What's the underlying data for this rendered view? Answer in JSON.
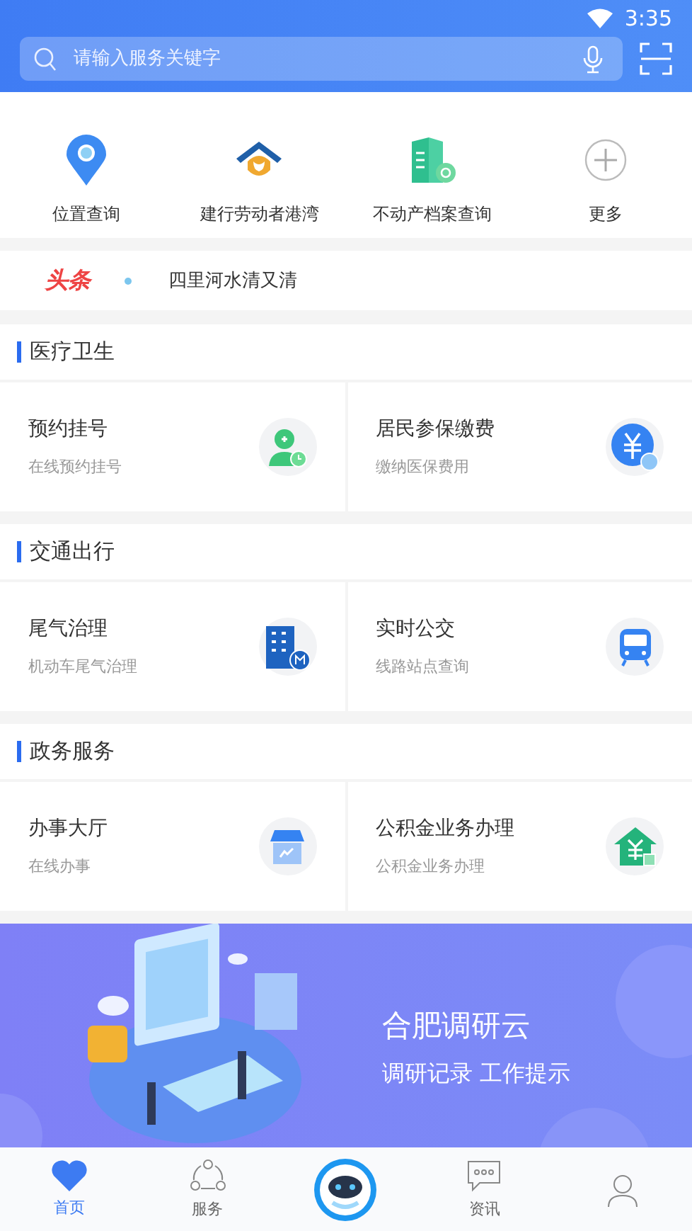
{
  "status_bar": {
    "time": "3:35"
  },
  "search": {
    "placeholder": "请输入服务关键字"
  },
  "quick_services": [
    {
      "kind": "pin",
      "label": "位置查询"
    },
    {
      "kind": "house",
      "label": "建行劳动者港湾"
    },
    {
      "kind": "building",
      "label": "不动产档案查询"
    },
    {
      "kind": "more",
      "label": "更多"
    }
  ],
  "headline": {
    "source": "头条",
    "text": "四里河水清又清"
  },
  "sections": [
    {
      "title": "医疗卫生",
      "cards": [
        {
          "kind": "doctor",
          "title": "预约挂号",
          "subtitle": "在线预约挂号"
        },
        {
          "kind": "yuan",
          "title": "居民参保缴费",
          "subtitle": "缴纳医保费用"
        }
      ]
    },
    {
      "title": "交通出行",
      "cards": [
        {
          "kind": "office",
          "title": "尾气治理",
          "subtitle": "机动车尾气治理"
        },
        {
          "kind": "bus",
          "title": "实时公交",
          "subtitle": "线路站点查询"
        }
      ]
    },
    {
      "title": "政务服务",
      "cards": [
        {
          "kind": "shop",
          "title": "办事大厅",
          "subtitle": "在线办事"
        },
        {
          "kind": "fund",
          "title": "公积金业务办理",
          "subtitle": "公积金业务办理"
        }
      ]
    }
  ],
  "banner": {
    "title": "合肥调研云",
    "subtitle": "调研记录 工作提示"
  },
  "tab_bar": [
    {
      "kind": "heart",
      "label": "首页",
      "selected": true
    },
    {
      "kind": "share",
      "label": "服务",
      "selected": false
    },
    {
      "kind": "robot",
      "selected": false
    },
    {
      "kind": "chat",
      "label": "资讯",
      "selected": false
    },
    {
      "kind": "person",
      "selected": false
    }
  ]
}
